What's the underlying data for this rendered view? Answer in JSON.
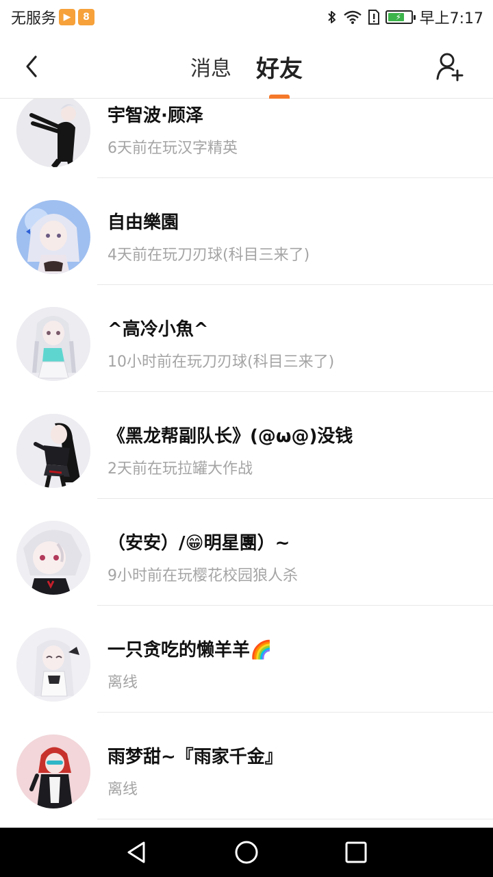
{
  "status_bar": {
    "carrier": "无服务",
    "time": "早上7:17",
    "battery_level": 0.75,
    "icons": [
      "play-app-icon",
      "b-app-icon",
      "bluetooth-icon",
      "wifi-icon",
      "sim-alert-icon",
      "battery-icon"
    ]
  },
  "header": {
    "tabs": [
      {
        "label": "消息",
        "active": false
      },
      {
        "label": "好友",
        "active": true
      }
    ],
    "accent_color": "#f5792a",
    "icons": [
      "back-arrow-icon",
      "add-friend-icon"
    ]
  },
  "friends": [
    {
      "name": "宇智波·顾泽",
      "status": "6天前在玩汉字精英"
    },
    {
      "name": "自由樂園",
      "status": "4天前在玩刀刃球(科目三来了)"
    },
    {
      "name": "^高冷小魚^",
      "status": "10小时前在玩刀刃球(科目三来了)"
    },
    {
      "name": "《黑龙帮副队长》(@ω@)没钱",
      "status": "2天前在玩拉罐大作战"
    },
    {
      "name": "（安安）/😁明星團）~",
      "status": "9小时前在玩樱花校园狼人杀"
    },
    {
      "name": "一只贪吃的懒羊羊🌈",
      "status": "离线"
    },
    {
      "name": "雨梦甜~『雨家千金』",
      "status": "离线"
    }
  ],
  "nav_bar": {
    "icons": [
      "nav-back-icon",
      "nav-home-icon",
      "nav-recent-icon"
    ]
  }
}
